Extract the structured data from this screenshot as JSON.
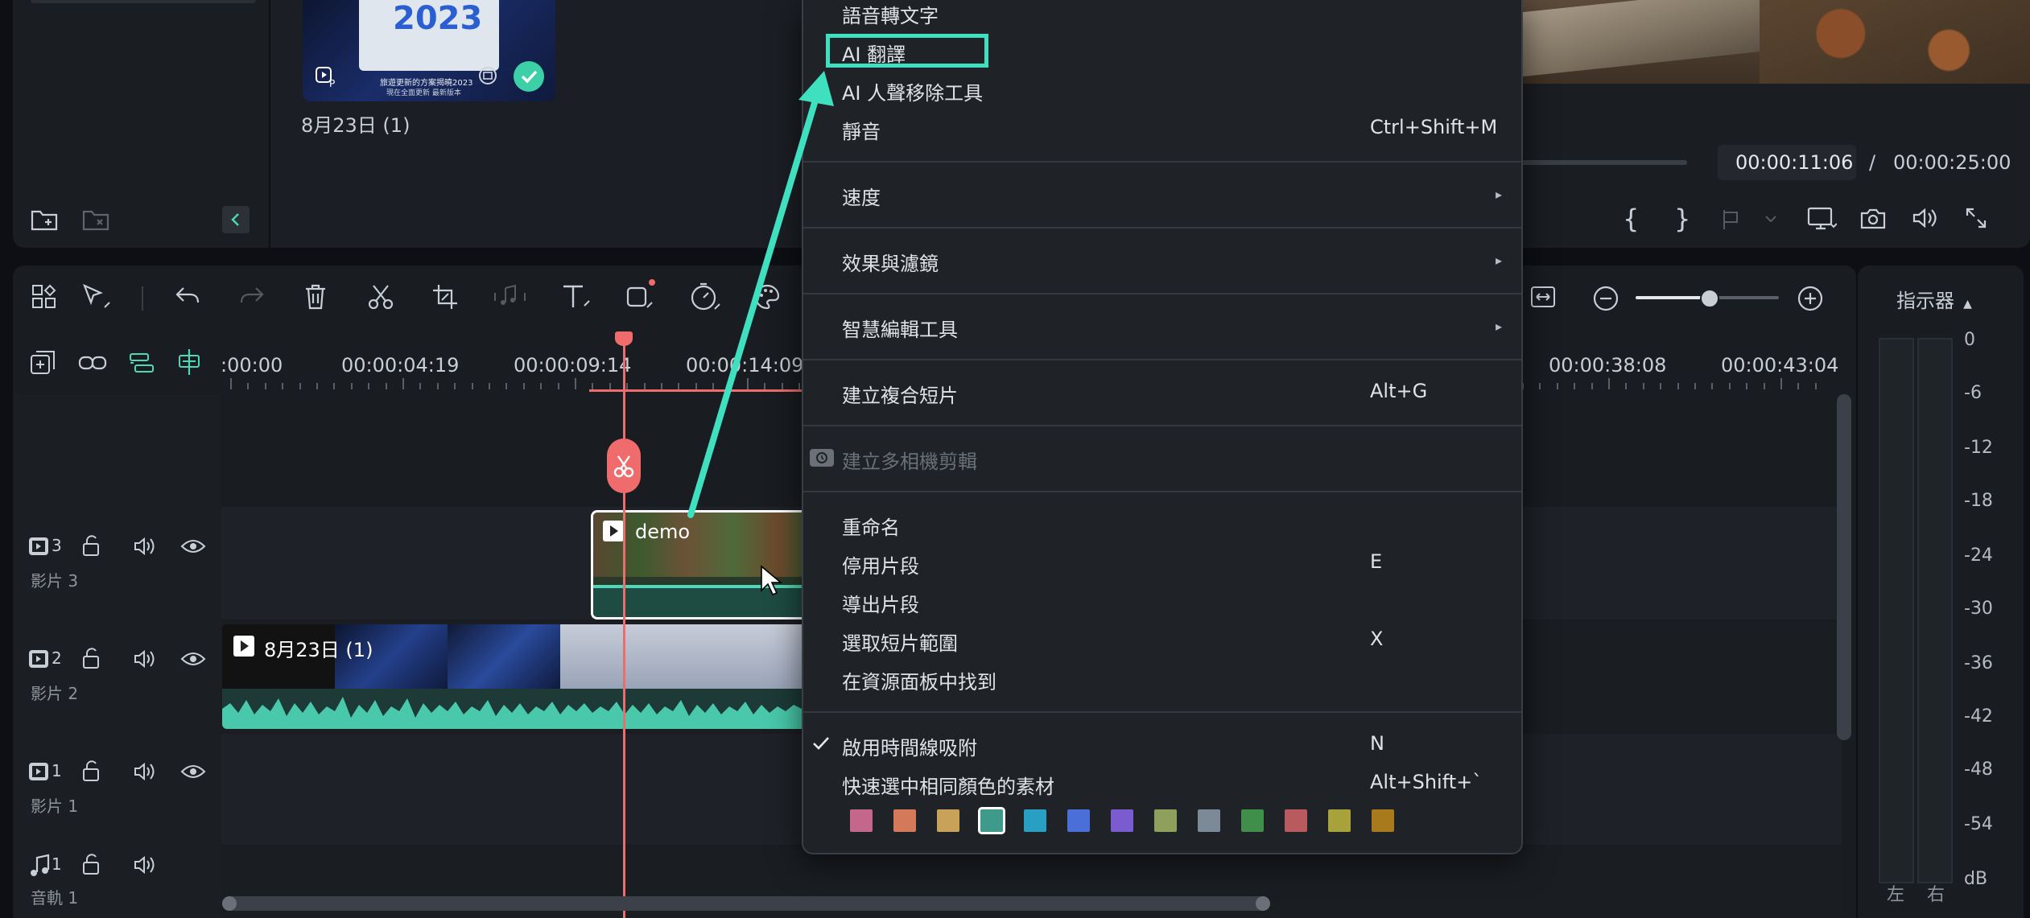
{
  "media": {
    "thumb_year": "2023",
    "thumb_caption_1": "旅遊更新的方案揭曉2023",
    "thumb_caption_2": "現在全面更新 最新版本",
    "date_label": "8月23日 (1)"
  },
  "preview": {
    "current_time": "00:00:11:06",
    "separator": "/",
    "total_time": "00:00:25:00"
  },
  "meter": {
    "label": "指示器",
    "scale": [
      "0",
      "-6",
      "-12",
      "-18",
      "-24",
      "-30",
      "-36",
      "-42",
      "-48",
      "-54",
      "dB"
    ],
    "left": "左",
    "right": "右"
  },
  "ruler": {
    "labels": [
      ":00:00",
      "00:00:04:19",
      "00:00:09:14",
      "00:00:14:09",
      "00:00:38:08",
      "00:00:43:04"
    ]
  },
  "tracks": [
    {
      "num": "3",
      "name": "影片 3",
      "clip": "demo"
    },
    {
      "num": "2",
      "name": "影片 2",
      "clip": "8月23日 (1)"
    },
    {
      "num": "1",
      "name": "影片 1"
    },
    {
      "num": "1",
      "name": "音軌 1"
    }
  ],
  "context_menu": {
    "items": [
      {
        "label": "語音轉文字"
      },
      {
        "label": "AI 翻譯",
        "highlighted": true
      },
      {
        "label": "AI 人聲移除工具"
      },
      {
        "label": "靜音",
        "shortcut": "Ctrl+Shift+M"
      },
      {
        "label": "速度",
        "submenu": true
      },
      {
        "label": "效果與濾鏡",
        "submenu": true
      },
      {
        "label": "智慧編輯工具",
        "submenu": true
      },
      {
        "label": "建立複合短片",
        "shortcut": "Alt+G"
      },
      {
        "label": "建立多相機剪輯",
        "disabled": true
      },
      {
        "label": "重命名"
      },
      {
        "label": "停用片段",
        "shortcut": "E"
      },
      {
        "label": "導出片段"
      },
      {
        "label": "選取短片範圍",
        "shortcut": "X"
      },
      {
        "label": "在資源面板中找到"
      },
      {
        "label": "啟用時間線吸附",
        "shortcut": "N",
        "checked": true
      },
      {
        "label": "快速選中相同顏色的素材",
        "shortcut": "Alt+Shift+`"
      }
    ],
    "swatches": [
      "#c4678a",
      "#d47a5a",
      "#c9a25a",
      "#3e9a8a",
      "#2a9fc4",
      "#4a6fd8",
      "#7b5cd0",
      "#8fa05c",
      "#7b8a96",
      "#3f8f4a",
      "#b85a5e",
      "#a8a23c",
      "#a87a1c"
    ],
    "selected_swatch_index": 3
  },
  "colors": {
    "accent": "#4fd8b8",
    "playhead": "#f06c6c",
    "highlight_box": "#3fe0c0"
  }
}
